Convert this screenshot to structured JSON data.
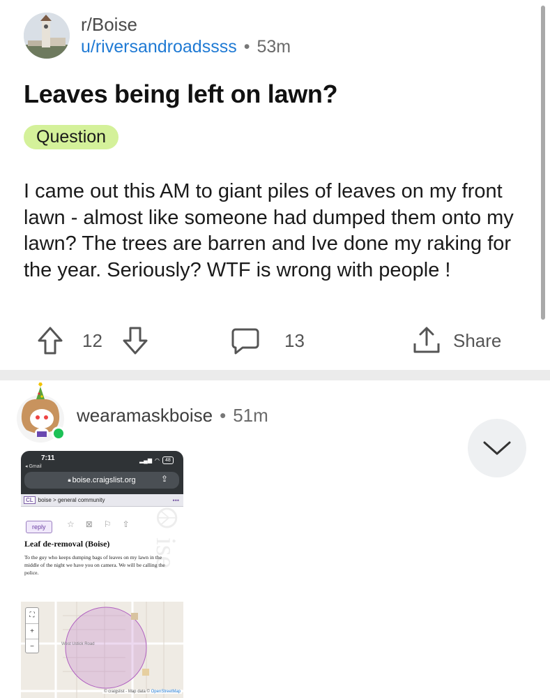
{
  "post": {
    "subreddit": "r/Boise",
    "author": "u/riversandroadssss",
    "separator": "•",
    "age": "53m",
    "title": "Leaves being left on lawn?",
    "flair": "Question",
    "body": "I came out this AM to giant piles of leaves on my front lawn - almost like someone had dumped them onto my lawn? The trees are barren and Ive done my raking for the year. Seriously? WTF is wrong with people !",
    "upvotes": "12",
    "comments": "13",
    "share_label": "Share"
  },
  "comment": {
    "author": "wearamaskboise",
    "separator": "•",
    "age": "51m",
    "image": {
      "status_time": "7:11",
      "back_app": "◂ Gmail",
      "battery": "48",
      "url": "boise.craigslist.org",
      "breadcrumb_logo": "CL",
      "breadcrumb": "boise > general community",
      "reply_label": "reply",
      "heading": "Leaf de-removal (Boise)",
      "text": "To the guy who keeps dumping bags of leaves on my lawn in the middle of the night we have you on camera. We will be calling the police.",
      "map_road": "West Ustick Road",
      "map_attribution": "© craigslist - Map data ©",
      "map_attribution_link": "OpenStreetMap"
    }
  },
  "colors": {
    "username": "#1f7ad4",
    "flair_bg": "#d4f19a",
    "online": "#1cc156",
    "divider": "#ebebeb"
  },
  "icons": [
    "upvote-icon",
    "downvote-icon",
    "comment-icon",
    "share-icon",
    "chevron-down-icon"
  ]
}
